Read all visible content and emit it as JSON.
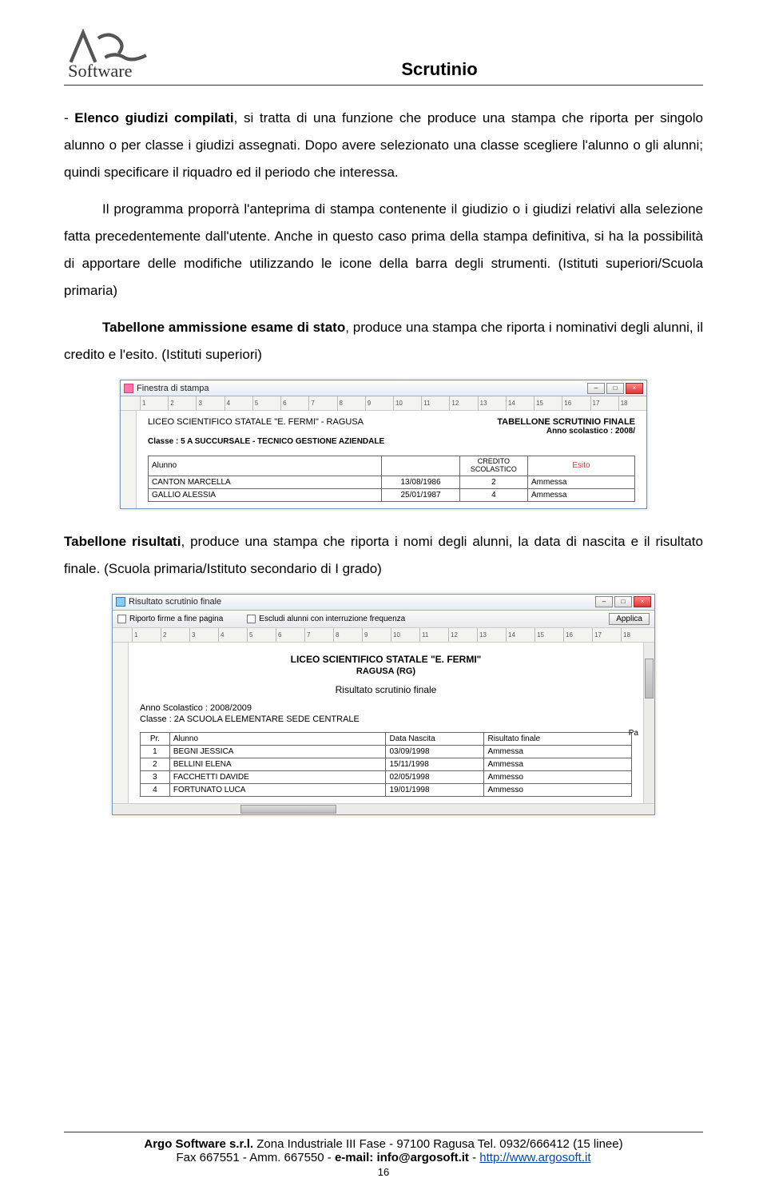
{
  "header": {
    "logo_top": "ARGO",
    "logo_bottom": "Software",
    "title": "Scrutinio"
  },
  "paragraphs": {
    "p1_lead": "Elenco giudizi compilati",
    "p1_rest": ", si tratta di una funzione che produce una stampa che riporta per singolo alunno o per classe i giudizi assegnati. Dopo avere selezionato una classe scegliere l'alunno o gli alunni; quindi specificare il riquadro ed il periodo che interessa.",
    "p2": "Il programma proporrà l'anteprima di stampa contenente il giudizio o i giudizi relativi alla selezione fatta precedentemente dall'utente. Anche in questo caso prima della stampa definitiva, si ha la possibilità di apportare delle modifiche utilizzando le icone della barra degli strumenti. (Istituti superiori/Scuola primaria)",
    "p3_lead": "Tabellone ammissione esame di stato",
    "p3_rest": ", produce una stampa che riporta i nominativi degli alunni, il credito e l'esito. (Istituti superiori)",
    "p4_lead": "Tabellone risultati",
    "p4_rest": ", produce una stampa che riporta i nomi degli alunni, la data di nascita e il risultato finale",
    "p4_tail": " (Scuola primaria/Istituto secondario di I grado)"
  },
  "window1": {
    "title": "Finestra di stampa",
    "ruler": [
      "1",
      "2",
      "3",
      "4",
      "5",
      "6",
      "7",
      "8",
      "9",
      "10",
      "11",
      "12",
      "13",
      "14",
      "15",
      "16",
      "17",
      "18"
    ],
    "school": "LICEO SCIENTIFICO STATALE \"E. FERMI\" - RAGUSA",
    "finale": "TABELLONE SCRUTINIO FINALE",
    "anno": "Anno scolastico : 2008/",
    "classe": "Classe : 5 A SUCCURSALE - TECNICO GESTIONE AZIENDALE",
    "headers": {
      "alunno": "Alunno",
      "credito": "CREDITO SCOLASTICO",
      "esito": "Esito"
    },
    "rows": [
      {
        "name": "CANTON MARCELLA",
        "date": "13/08/1986",
        "credito": "2",
        "esito": "Ammessa"
      },
      {
        "name": "GALLIO ALESSIA",
        "date": "25/01/1987",
        "credito": "4",
        "esito": "Ammessa"
      }
    ]
  },
  "window2": {
    "title": "Risultato scrutinio finale",
    "chk1": "Riporto firme a fine pagina",
    "chk2": "Escludi alunni con interruzione frequenza",
    "applica": "Applica",
    "ruler": [
      "1",
      "2",
      "3",
      "4",
      "5",
      "6",
      "7",
      "8",
      "9",
      "10",
      "11",
      "12",
      "13",
      "14",
      "15",
      "16",
      "17",
      "18"
    ],
    "school": "LICEO SCIENTIFICO STATALE \"E. FERMI\"",
    "city": "RAGUSA (RG)",
    "subtitle": "Risultato scrutinio finale",
    "anno": "Anno Scolastico : 2008/2009",
    "classe": "Classe : 2A SCUOLA ELEMENTARE SEDE CENTRALE",
    "pa": "Pa",
    "headers": {
      "pr": "Pr.",
      "alunno": "Alunno",
      "data": "Data Nascita",
      "risultato": "Risultato finale"
    },
    "rows": [
      {
        "pr": "1",
        "name": "BEGNI JESSICA",
        "date": "03/09/1998",
        "ris": "Ammessa"
      },
      {
        "pr": "2",
        "name": "BELLINI ELENA",
        "date": "15/11/1998",
        "ris": "Ammessa"
      },
      {
        "pr": "3",
        "name": "FACCHETTI DAVIDE",
        "date": "02/05/1998",
        "ris": "Ammesso"
      },
      {
        "pr": "4",
        "name": "FORTUNATO LUCA",
        "date": "19/01/1998",
        "ris": "Ammesso"
      }
    ]
  },
  "footer": {
    "line1_a": "Argo Software s.r.l.",
    "line1_b": " Zona Industriale III Fase - 97100 Ragusa Tel. 0932/666412 (15 linee)",
    "line2_a": "Fax 667551 - Amm. 667550 - ",
    "line2_b": "e-mail: info@argosoft.it",
    "line2_c": " - ",
    "link": "http://www.argosoft.it",
    "page": "16"
  }
}
